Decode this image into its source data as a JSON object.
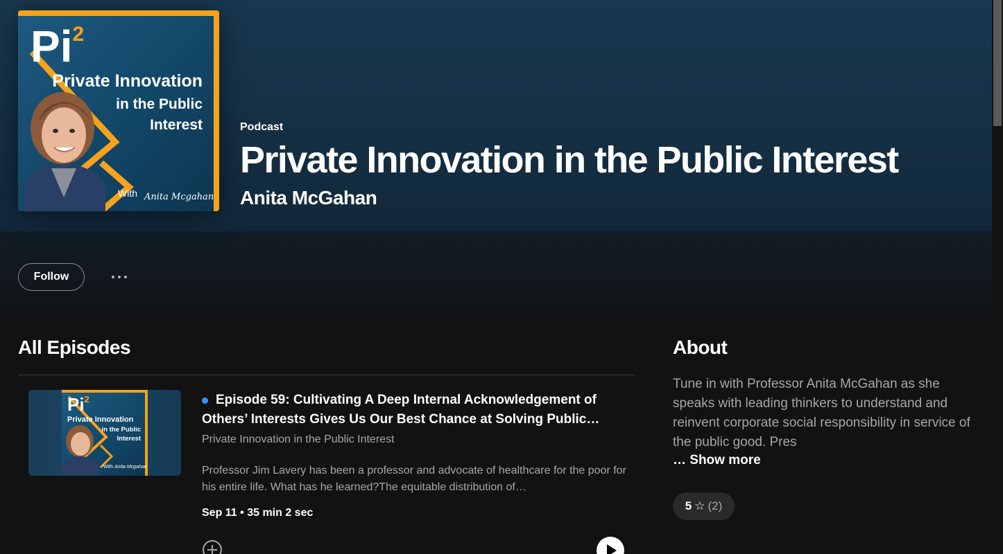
{
  "cover": {
    "logo_text": "Pi",
    "logo_sup": "2",
    "title_line1": "Private Innovation",
    "title_line2": "in the Public",
    "title_line3": "Interest",
    "with_text": "With",
    "signature": "Anita Mcgahan"
  },
  "header": {
    "kind": "Podcast",
    "title": "Private Innovation in the Public Interest",
    "author": "Anita McGahan"
  },
  "actions": {
    "follow_label": "Follow"
  },
  "episodes": {
    "heading": "All Episodes",
    "items": [
      {
        "title": "Episode 59: Cultivating A Deep Internal Acknowledgement of Others’ Interests Gives Us Our Best Chance at Solving Public…",
        "show": "Private Innovation in the Public Interest",
        "description": "Professor Jim Lavery has been a professor and advocate of healthcare for the poor for his entire life. What has he learned?The equitable distribution of…",
        "meta": "Sep 11 • 35 min 2 sec",
        "unplayed": true
      }
    ]
  },
  "about": {
    "heading": "About",
    "text": "Tune in with Professor Anita McGahan as she speaks with leading thinkers to understand and reinvent corporate social responsibility in service of the public good. Pres",
    "show_more": "… Show more",
    "rating_value": "5",
    "rating_count": "(2)"
  },
  "colors": {
    "accent_orange": "#f6a21b",
    "unplayed_dot": "#3d91f4",
    "header_bg": "#183850",
    "page_bg": "#121212"
  }
}
